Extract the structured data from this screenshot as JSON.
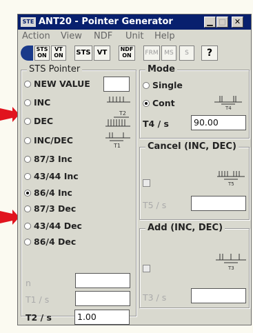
{
  "window": {
    "app_icon": "STE",
    "title": "ANT20 - Pointer Generator"
  },
  "menu": [
    "Action",
    "View",
    "NDF",
    "Unit",
    "Help"
  ],
  "toolbar": {
    "sts_on_top": "STS",
    "sts_on_bottom": "ON",
    "vt_on_top": "VT",
    "vt_on_bottom": "ON",
    "sts": "STS",
    "vt": "VT",
    "ndf_on_top": "NDF",
    "ndf_on_bottom": "ON",
    "frm": "FRM",
    "ms": "MS",
    "s": "S",
    "help": "?"
  },
  "sts_pointer": {
    "title": "STS Pointer",
    "options": [
      "NEW VALUE",
      "INC",
      "DEC",
      "INC/DEC",
      "87/3 Inc",
      "43/44 Inc",
      "86/4 Inc",
      "87/3 Dec",
      "43/44 Dec",
      "86/4 Dec"
    ],
    "selected": "86/4 Inc",
    "new_value": "",
    "diagram_labels": {
      "t2": "T2",
      "t1": "T1"
    },
    "n_label": "n",
    "n_value": "",
    "t1_label": "T1 / s",
    "t1_value": "",
    "t2_label": "T2 / s",
    "t2_value": "1.00"
  },
  "mode": {
    "title": "Mode",
    "single": "Single",
    "cont": "Cont",
    "selected": "Cont",
    "t4_label": "T4 / s",
    "t4_value": "90.00",
    "t4_diagram": "T4"
  },
  "cancel": {
    "title": "Cancel (INC, DEC)",
    "t5_label": "T5 / s",
    "t5_value": "",
    "t5_diagram": "T5"
  },
  "add": {
    "title": "Add (INC, DEC)",
    "t3_label": "T3 / s",
    "t3_value": "",
    "t3_diagram": "T3"
  },
  "colors": {
    "title_bg": "#08206e",
    "window_bg": "#d9d9cf",
    "arrow": "#e1141e",
    "paper": "#fbfaf1"
  }
}
